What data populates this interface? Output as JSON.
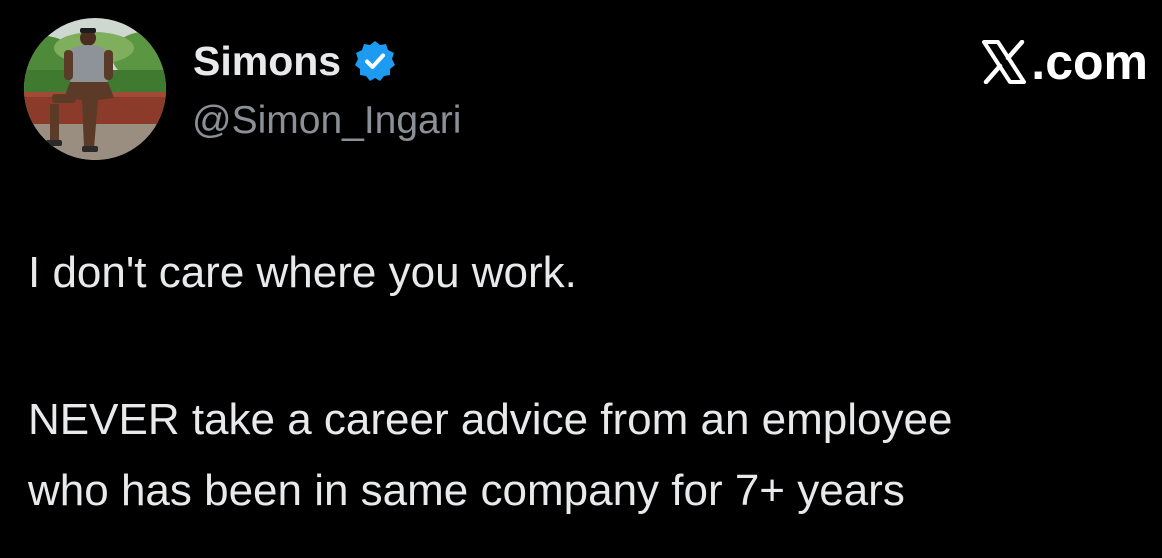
{
  "author": {
    "display_name": "Simons",
    "handle": "@Simon_Ingari",
    "verified": true
  },
  "site": {
    "logo_icon": "x-logo-icon",
    "suffix": ".com"
  },
  "tweet": {
    "lines": [
      "I don't care where you work.",
      "NEVER take a career advice from an employee",
      "who has been in same company for 7+ years"
    ]
  },
  "colors": {
    "background": "#000000",
    "text": "#e7e9ea",
    "secondary_text": "#8b9096",
    "verified_blue": "#1d9bf0"
  }
}
